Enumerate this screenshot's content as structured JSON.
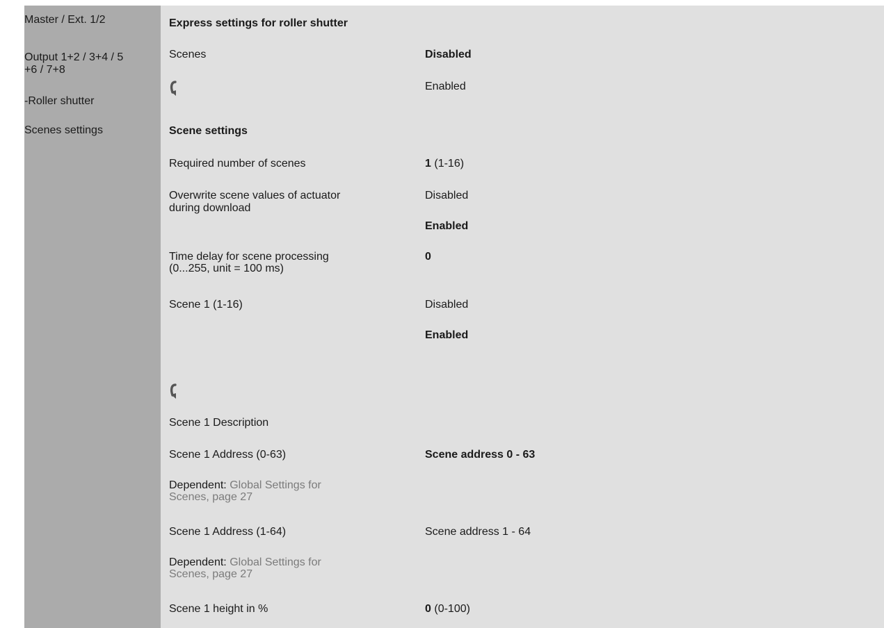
{
  "nav": {
    "items": [
      "Master / Ext. 1/2",
      [
        "Output 1+2 / 3+4 / 5",
        "+6 / 7+8"
      ],
      "-Roller shutter",
      "Scenes settings"
    ]
  },
  "main": {
    "heading_express": "Express settings for roller shutter",
    "scenes": {
      "label": "Scenes",
      "option_disabled": "Disabled",
      "option_enabled": "Enabled"
    },
    "scene_settings": "Scene settings",
    "required_scenes": {
      "label": "Required number of scenes",
      "value": "1",
      "range": "(1-16)"
    },
    "overwrite": {
      "label_lines": [
        "Overwrite scene values of actuator",
        "during download"
      ],
      "option_disabled": "Disabled",
      "option_enabled": "Enabled"
    },
    "time_delay": {
      "label_lines": [
        "Time delay for scene processing",
        "(0...255, unit = 100 ms)"
      ],
      "value": "0"
    },
    "scene1": {
      "label": "Scene 1 (1-16)",
      "option_disabled": "Disabled",
      "option_enabled": "Enabled"
    },
    "scene1_description": "Scene 1 Description",
    "address_0_63": {
      "label": "Scene 1 Address (0-63)",
      "value": "Scene address 0 - 63",
      "dependent_label": "Dependent:",
      "dependent_link_lines": [
        "Global Settings for",
        "Scenes, page 27"
      ]
    },
    "address_1_64": {
      "label": "Scene 1 Address (1-64)",
      "value": "Scene address 1 - 64",
      "dependent_label": "Dependent:",
      "dependent_link_lines": [
        "Global Settings for",
        "Scenes, page 27"
      ]
    },
    "height": {
      "label": "Scene 1 height in %",
      "value": "0",
      "range": "(0-100)"
    }
  },
  "icons": {
    "shutter": "roller-shutter-curved-arrow-icon"
  },
  "colors": {
    "nav_bg": "#ababab",
    "main_bg": "#e0e0e0",
    "text": "#1a1a1a",
    "link": "#7b7b7b",
    "icon": "#555555"
  }
}
